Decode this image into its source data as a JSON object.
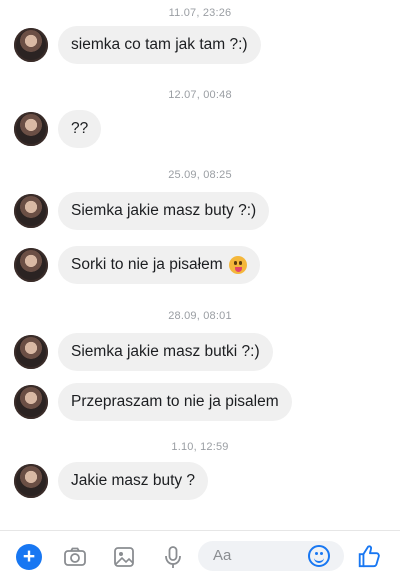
{
  "thread": {
    "groups": [
      {
        "time": "11.07, 23:26",
        "messages": [
          "siemka co tam jak tam ?:)"
        ]
      },
      {
        "time": "12.07, 00:48",
        "messages": [
          "??"
        ]
      },
      {
        "time": "25.09, 08:25",
        "messages": [
          "Siemka jakie masz buty ?:)",
          "Sorki to nie ja pisałem"
        ]
      },
      {
        "time": "28.09, 08:01",
        "messages": [
          "Siemka jakie masz butki ?:)",
          "Przepraszam to nie ja pisalem"
        ]
      },
      {
        "time": "1.10, 12:59",
        "messages": [
          "Jakie masz buty ?"
        ]
      }
    ],
    "emoji": "tongue-face-emoji"
  },
  "composer": {
    "placeholder": "Aa",
    "icons": [
      "plus-icon",
      "camera-icon",
      "image-icon",
      "microphone-icon",
      "smile-icon",
      "like-icon"
    ],
    "accent_color": "#1877f2"
  }
}
